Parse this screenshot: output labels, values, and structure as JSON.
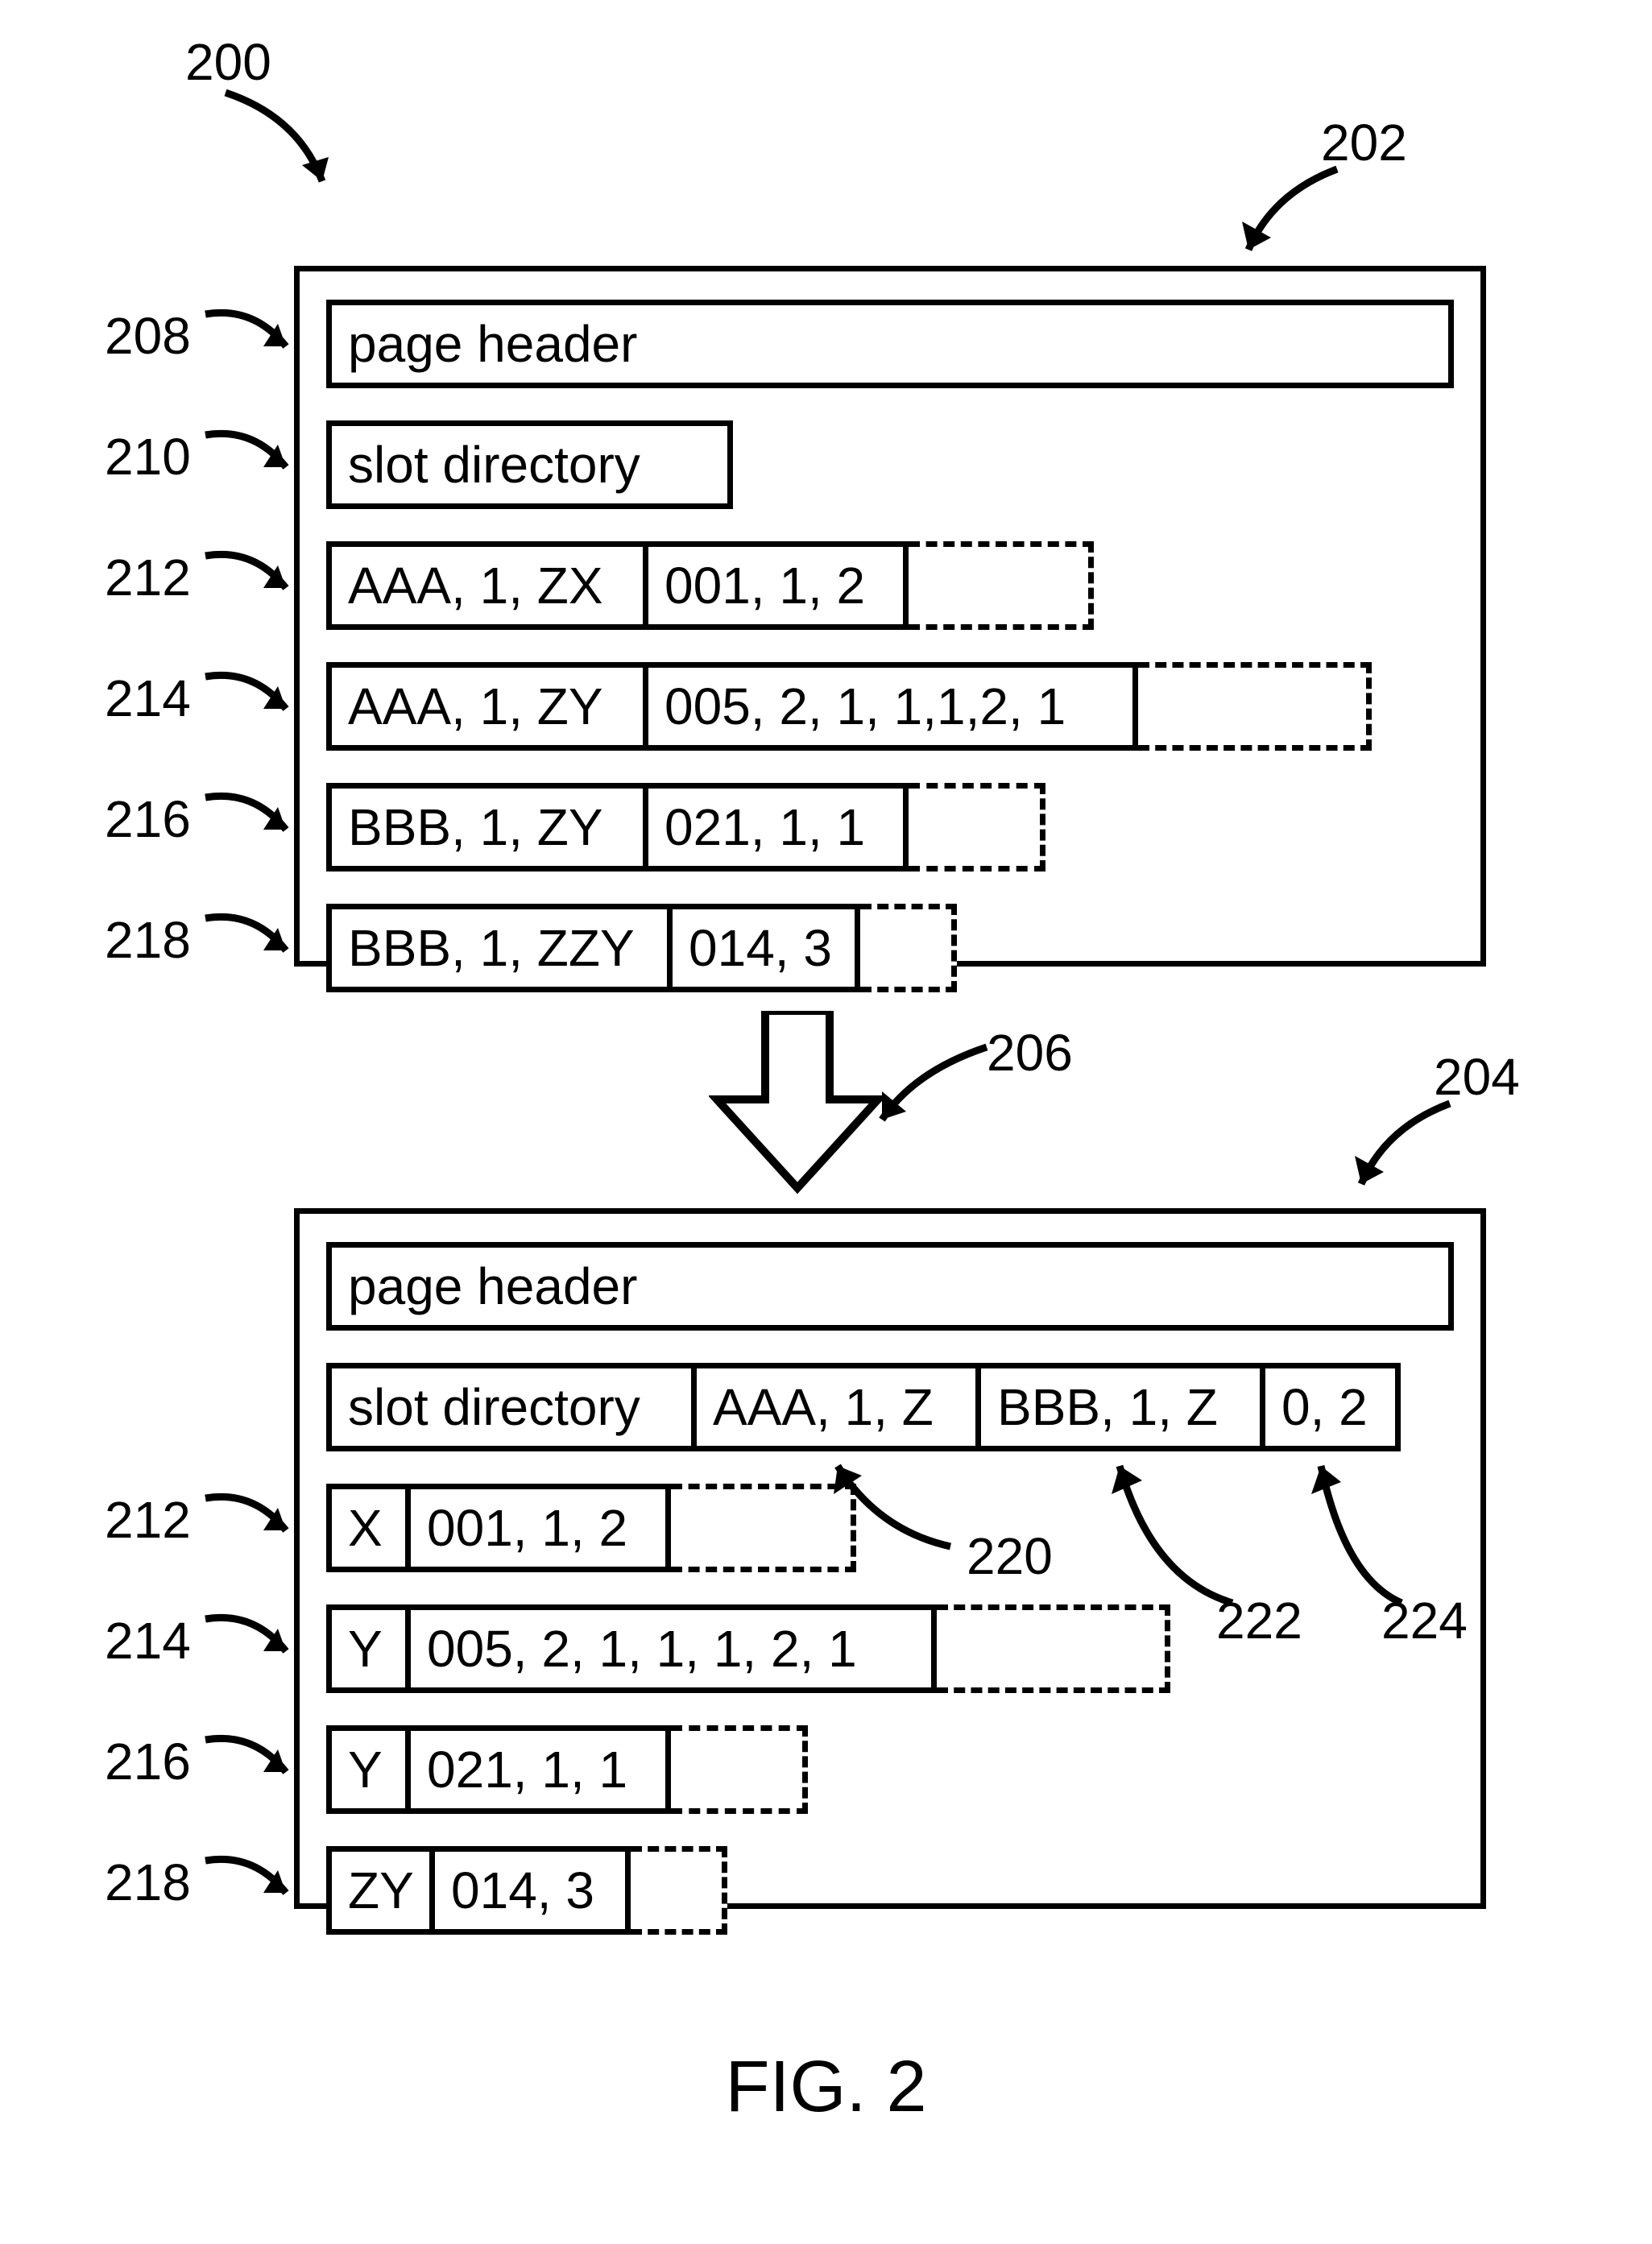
{
  "refs": {
    "r200": "200",
    "r202": "202",
    "r204": "204",
    "r206": "206",
    "r208": "208",
    "r210": "210",
    "r212a": "212",
    "r214a": "214",
    "r216a": "216",
    "r218a": "218",
    "r212b": "212",
    "r214b": "214",
    "r216b": "216",
    "r218b": "218",
    "r220": "220",
    "r222": "222",
    "r224": "224"
  },
  "top": {
    "page_header": "page header",
    "slot_dir": "slot directory",
    "rows": {
      "r212": {
        "a": "AAA, 1, ZX",
        "b": "001, 1, 2"
      },
      "r214": {
        "a": "AAA, 1, ZY",
        "b": "005, 2, 1, 1,1,2, 1"
      },
      "r216": {
        "a": "BBB, 1, ZY",
        "b": "021, 1, 1"
      },
      "r218": {
        "a": "BBB, 1, ZZY",
        "b": "014, 3"
      }
    }
  },
  "bottom": {
    "page_header": "page header",
    "slot_dir": "slot directory",
    "sd_a": "AAA, 1, Z",
    "sd_b": "BBB, 1, Z",
    "sd_c": "0, 2",
    "rows": {
      "r212": {
        "a": "X",
        "b": "001, 1, 2"
      },
      "r214": {
        "a": "Y",
        "b": "005, 2, 1, 1, 1, 2, 1"
      },
      "r216": {
        "a": "Y",
        "b": "021, 1, 1"
      },
      "r218": {
        "a": "ZY",
        "b": "014, 3"
      }
    }
  },
  "caption": "FIG. 2"
}
